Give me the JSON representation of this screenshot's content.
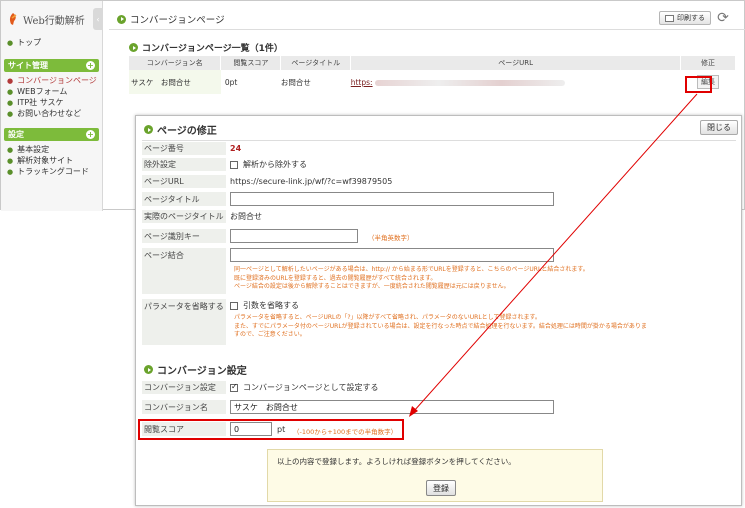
{
  "app": {
    "logo": "Web行動解析",
    "sidebar": {
      "top_link": "トップ",
      "site_section": "サイト管理",
      "site_items": [
        "コンバージョンページ",
        "WEBフォーム",
        "ITP社 サスケ",
        "お問い合わせなど"
      ],
      "settings_section": "設定",
      "settings_items": [
        "基本設定",
        "解析対象サイト",
        "トラッキングコード"
      ]
    },
    "header": {
      "title": "コンバージョンページ",
      "print_label": "印刷する"
    },
    "list": {
      "title": "コンバージョンページ一覧（1件）",
      "columns": [
        "コンバージョン名",
        "閲覧スコア",
        "ページタイトル",
        "ページURL",
        "修正"
      ],
      "rows": [
        {
          "name": "サスケ　お問合せ",
          "score": "0pt",
          "page_title": "お問合せ",
          "url_prefix": "https:",
          "edit": "編集"
        }
      ]
    }
  },
  "modal": {
    "title": "ページの修正",
    "close_label": "閉じる",
    "page_number": {
      "label": "ページ番号",
      "value": "24"
    },
    "exclude": {
      "label": "除外設定",
      "option": "解析から除外する",
      "checked": false
    },
    "page_url": {
      "label": "ページURL",
      "value": "https://secure-link.jp/wf/?c=wf39879505"
    },
    "page_title": {
      "label": "ページタイトル",
      "value": ""
    },
    "actual_title": {
      "label": "実際のページタイトル",
      "value": "お問合せ"
    },
    "page_key": {
      "label": "ページ識別キー",
      "value": "",
      "hint": "（半角英数字）"
    },
    "page_merge": {
      "label": "ページ結合",
      "value": "",
      "notes": [
        "同一ページとして解析したいページがある場合は、http:// から始まる形でURLを登録すると、こちらのページURLと結合されます。",
        "既に登録済みのURLを登録すると、過去の閲覧履歴がすべて統合されます。",
        "ページ結合の設定は後から解除することはできますが、一度統合された閲覧履歴は元には戻りません。"
      ]
    },
    "omit_params": {
      "label": "パラメータを省略する",
      "option": "引数を省略する",
      "checked": false,
      "notes": [
        "パラメータを省略すると、ページURLの「?」以降がすべて省略され、パラメータのないURLとして登録されます。",
        "また、すでにパラメータ付のページURLが登録されている場合は、設定を行なった時点で結合処理を行ないます。結合処理には時間が掛かる場合がありま",
        "すので、ご注意ください。"
      ]
    },
    "conversion": {
      "title": "コンバージョン設定",
      "setting_label": "コンバージョン設定",
      "setting_option": "コンバージョンページとして設定する",
      "setting_checked": true,
      "name_label": "コンバージョン名",
      "name_value": "サスケ　お問合せ",
      "score_label": "閲覧スコア",
      "score_value": "0",
      "score_unit": "pt",
      "score_hint": "（-100から+100までの半角数字）"
    },
    "confirm": {
      "text": "以上の内容で登録します。よろしければ登録ボタンを押してください。",
      "button": "登録"
    }
  },
  "colors": {
    "accent_green": "#7dbb3b",
    "highlight_red": "#e00000",
    "note_orange": "#e07020"
  }
}
